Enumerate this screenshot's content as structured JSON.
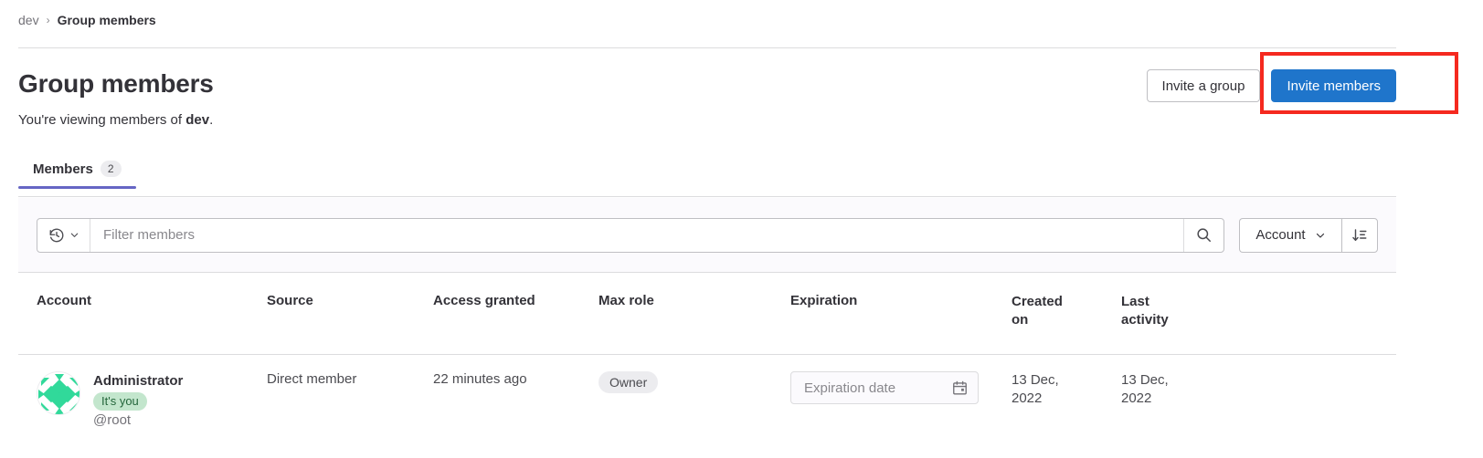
{
  "breadcrumb": {
    "root": "dev",
    "separator": "›",
    "current": "Group members"
  },
  "header": {
    "title": "Group members",
    "subtitle_prefix": "You're viewing members of ",
    "subtitle_group": "dev",
    "subtitle_suffix": ".",
    "invite_group_label": "Invite a group",
    "invite_members_label": "Invite members",
    "highlight_color": "#f5291f",
    "primary_color": "#1f75cb"
  },
  "tabs": [
    {
      "label": "Members",
      "count": "2",
      "active": true
    }
  ],
  "filter": {
    "history_icon": "history-icon",
    "chevron_icon": "chevron-down-icon",
    "placeholder": "Filter members",
    "value": "",
    "search_icon": "search-icon",
    "sort_field": "Account",
    "sort_direction_icon": "sort-descending-icon"
  },
  "table": {
    "columns": [
      {
        "key": "account",
        "label": "Account"
      },
      {
        "key": "source",
        "label": "Source"
      },
      {
        "key": "access",
        "label": "Access granted"
      },
      {
        "key": "role",
        "label": "Max role"
      },
      {
        "key": "expiration",
        "label": "Expiration"
      },
      {
        "key": "created_l1",
        "label": "Created"
      },
      {
        "key": "created_l2",
        "label": "on"
      },
      {
        "key": "last_l1",
        "label": "Last"
      },
      {
        "key": "last_l2",
        "label": "activity"
      }
    ],
    "rows": [
      {
        "name": "Administrator",
        "badge": "It's you",
        "handle": "@root",
        "avatar_icon": "identicon-avatar",
        "avatar_color": "#31d99a",
        "source": "Direct member",
        "access_granted": "22 minutes ago",
        "max_role": "Owner",
        "expiration_placeholder": "Expiration date",
        "expiration_value": "",
        "calendar_icon": "calendar-icon",
        "created_on_l1": "13 Dec,",
        "created_on_l2": "2022",
        "last_activity_l1": "13 Dec,",
        "last_activity_l2": "2022"
      }
    ]
  }
}
